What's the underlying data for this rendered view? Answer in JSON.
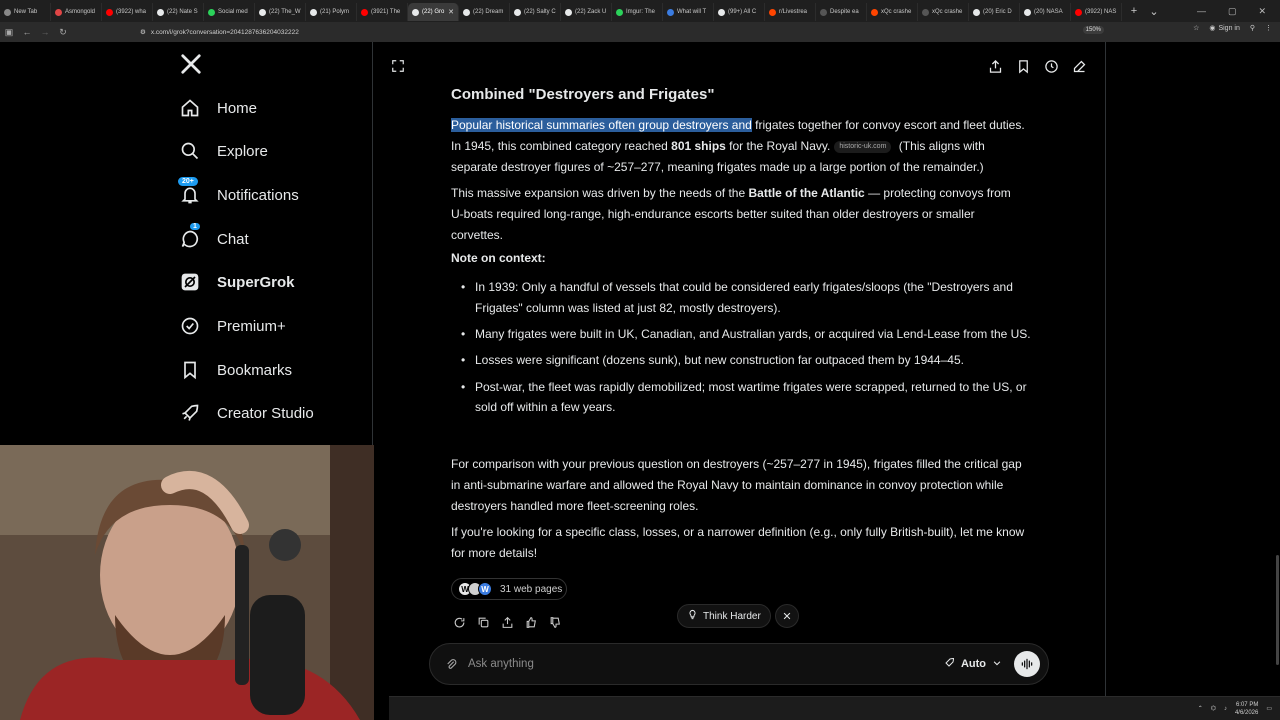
{
  "browser": {
    "tabs": [
      {
        "label": "New Tab",
        "color": "#888888"
      },
      {
        "label": "Asmongold",
        "color": "#e04646"
      },
      {
        "label": "(3922) wha",
        "color": "#ff0000"
      },
      {
        "label": "(22) Nate S",
        "color": "#e7e9ea"
      },
      {
        "label": "Social med",
        "color": "#2bd25a"
      },
      {
        "label": "(22) The_W",
        "color": "#e7e9ea"
      },
      {
        "label": "(21) Polym",
        "color": "#e7e9ea"
      },
      {
        "label": "(3921) The",
        "color": "#ff0000"
      },
      {
        "label": "(22) Gro",
        "color": "#e7e9ea",
        "active": true
      },
      {
        "label": "(22) Dream",
        "color": "#e7e9ea"
      },
      {
        "label": "(22) Salty C",
        "color": "#e7e9ea"
      },
      {
        "label": "(22) Zack U",
        "color": "#e7e9ea"
      },
      {
        "label": "Imgur: The",
        "color": "#2bd25a"
      },
      {
        "label": "What will T",
        "color": "#3b7ce0"
      },
      {
        "label": "(99+) All C",
        "color": "#e7e9ea"
      },
      {
        "label": "r/Livestrea",
        "color": "#ff4500"
      },
      {
        "label": "Despite ea",
        "color": "#555555"
      },
      {
        "label": "xQc crashe",
        "color": "#ff4500"
      },
      {
        "label": "xQc crashe",
        "color": "#555555"
      },
      {
        "label": "(20) Eric D",
        "color": "#e7e9ea"
      },
      {
        "label": "(20) NASA",
        "color": "#e7e9ea"
      },
      {
        "label": "(3922) NAS",
        "color": "#ff0000"
      }
    ],
    "url": "x.com/i/grok?conversation=2041287636204032222",
    "zoom": "150%",
    "signin_label": "Sign in"
  },
  "sidebar": {
    "items": [
      {
        "label": "Home",
        "icon": "home-icon"
      },
      {
        "label": "Explore",
        "icon": "search-icon"
      },
      {
        "label": "Notifications",
        "icon": "bell-icon",
        "badge": "20+"
      },
      {
        "label": "Chat",
        "icon": "chat-icon",
        "badge": "1"
      },
      {
        "label": "SuperGrok",
        "icon": "grok-icon"
      },
      {
        "label": "Premium+",
        "icon": "verified-icon"
      },
      {
        "label": "Bookmarks",
        "icon": "bookmark-icon"
      },
      {
        "label": "Creator Studio",
        "icon": "rocket-icon"
      }
    ]
  },
  "response": {
    "heading": "Combined \"Destroyers and Frigates\"",
    "p1_highlight": "Popular historical summaries often group destroyers and",
    "p1_a": " frigates together for convoy escort and fleet duties. In 1945, this combined category reached ",
    "p1_bold": "801 ships",
    "p1_b": " for the Royal Navy.",
    "p1_chip": "historic-uk.com",
    "p1_c": " (This aligns with separate destroyer figures of ~257–277, meaning frigates made up a large portion of the remainder.)",
    "p2_a": "This massive expansion was driven by the needs of the ",
    "p2_bold": "Battle of the Atlantic",
    "p2_b": " — protecting convoys from U-boats required long-range, high-endurance escorts better suited than older destroyers or smaller corvettes.",
    "note_heading": "Note on context:",
    "bullets": [
      "In 1939: Only a handful of vessels that could be considered early frigates/sloops (the \"Destroyers and Frigates\" column was listed at just 82, mostly destroyers).",
      "Many frigates were built in UK, Canadian, and Australian yards, or acquired via Lend-Lease from the US.",
      "Losses were significant (dozens sunk), but new construction far outpaced them by 1944–45.",
      "Post-war, the fleet was rapidly demobilized; most wartime frigates were scrapped, returned to the US, or sold off within a few years."
    ],
    "p3": "For comparison with your previous question on destroyers (~257–277 in 1945), frigates filled the critical gap in anti-submarine warfare and allowed the Royal Navy to maintain dominance in convoy protection while destroyers handled more fleet-screening roles.",
    "p4": "If you're looking for a specific class, losses, or a narrower definition (e.g., only fully British-built), let me know for more details!",
    "sources_label": "31 web pages"
  },
  "composer": {
    "think_harder_label": "Think Harder",
    "placeholder": "Ask anything",
    "mode_label": "Auto"
  },
  "taskbar": {
    "time": "6:07 PM",
    "date": "4/6/2026"
  }
}
